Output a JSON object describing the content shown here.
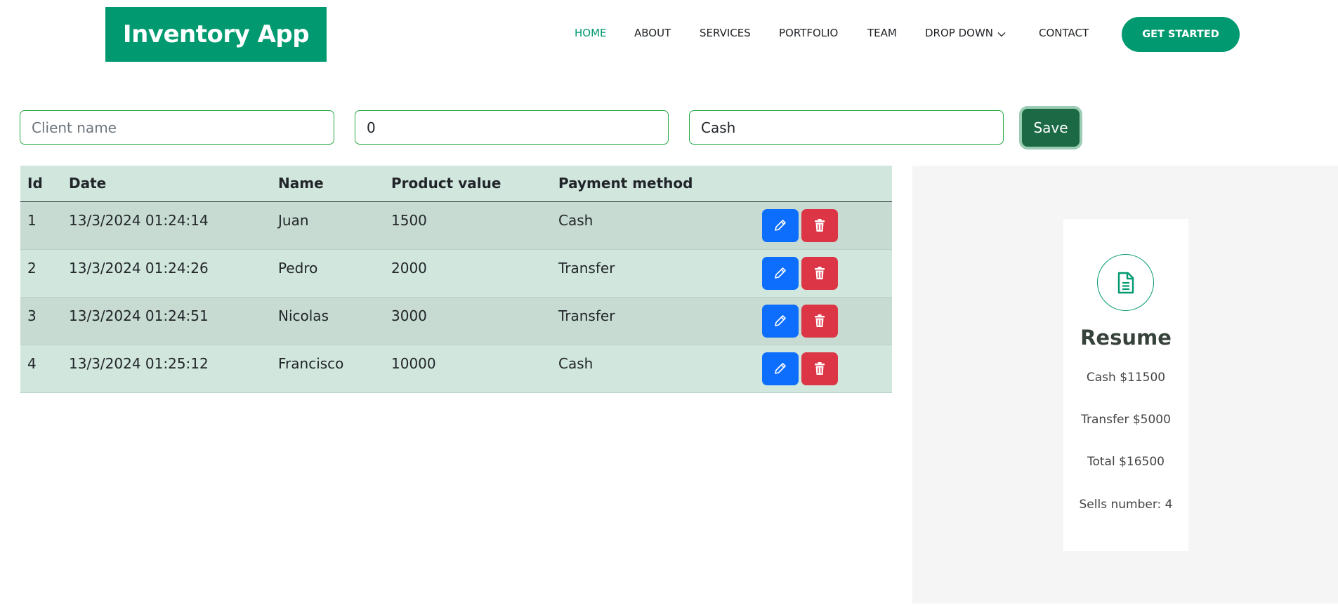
{
  "header": {
    "logo": "Inventory App",
    "nav": [
      {
        "label": "HOME",
        "active": true
      },
      {
        "label": "ABOUT"
      },
      {
        "label": "SERVICES"
      },
      {
        "label": "PORTFOLIO"
      },
      {
        "label": "TEAM"
      },
      {
        "label": "DROP DOWN",
        "icon": "chevron-down-icon"
      },
      {
        "label": "CONTACT"
      }
    ],
    "cta_label": "GET STARTED"
  },
  "form": {
    "client_placeholder": "Client name",
    "client_value": "",
    "value_field": "0",
    "payment_field": "Cash",
    "save_label": "Save"
  },
  "table": {
    "headers": [
      "Id",
      "Date",
      "Name",
      "Product value",
      "Payment method"
    ],
    "rows": [
      {
        "id": "1",
        "date": "13/3/2024 01:24:14",
        "name": "Juan",
        "value": "1500",
        "method": "Cash"
      },
      {
        "id": "2",
        "date": "13/3/2024 01:24:26",
        "name": "Pedro",
        "value": "2000",
        "method": "Transfer"
      },
      {
        "id": "3",
        "date": "13/3/2024 01:24:51",
        "name": "Nicolas",
        "value": "3000",
        "method": "Transfer"
      },
      {
        "id": "4",
        "date": "13/3/2024 01:25:12",
        "name": "Francisco",
        "value": "10000",
        "method": "Cash"
      }
    ]
  },
  "summary": {
    "icon": "document-icon",
    "title": "Resume",
    "cash": "Cash $11500",
    "transfer": "Transfer $5000",
    "total": "Total $16500",
    "sells": "Sells number: 4"
  },
  "colors": {
    "brand": "#009970",
    "save": "#1b6a45",
    "edit": "#0d6efd",
    "delete": "#dc3545",
    "table_bg": "#d1e7dd"
  }
}
